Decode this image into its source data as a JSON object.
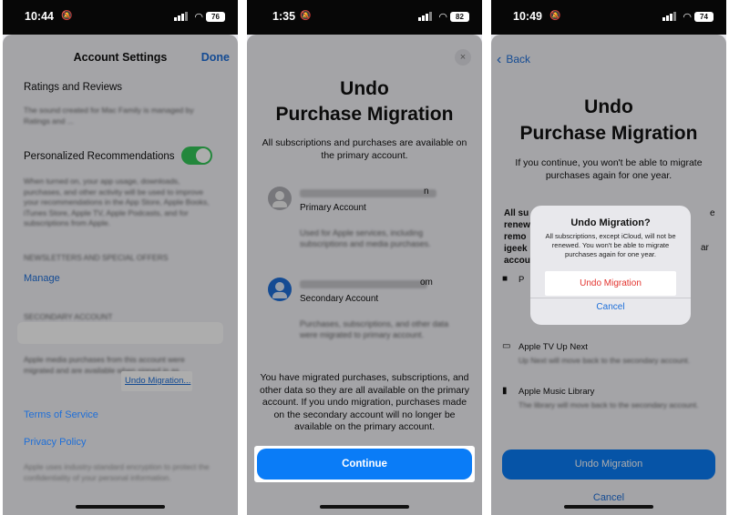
{
  "screens": [
    {
      "status": {
        "time": "10:44",
        "battery": "76"
      },
      "header": {
        "title": "Account Settings",
        "done": "Done"
      },
      "ratings": {
        "title": "Ratings and Reviews",
        "desc": "The sound created for Mac Family is managed by Ratings and ..."
      },
      "recommendations": {
        "title": "Personalized Recommendations",
        "desc": "When turned on, your app usage, downloads, purchases, and other activity will be used to improve your recommendations in the App Store, Apple Books, iTunes Store, Apple TV, Apple Podcasts, and for subscriptions from Apple."
      },
      "newsletters": {
        "header": "NEWSLETTERS AND SPECIAL OFFERS",
        "manage": "Manage"
      },
      "secondary": {
        "header": "SECONDARY ACCOUNT",
        "desc": "Apple media purchases from this account were migrated and are available when signed in as ...",
        "undo_link": "Undo Migration..."
      },
      "terms": "Terms of Service",
      "privacy": "Privacy Policy",
      "footer": "Apple uses industry-standard encryption to protect the confidentiality of your personal information."
    },
    {
      "status": {
        "time": "1:35",
        "battery": "82"
      },
      "close": "×",
      "title_line1": "Undo",
      "title_line2": "Purchase Migration",
      "subtitle": "All subscriptions and purchases are available on the primary account.",
      "primary": {
        "email_suffix": "n",
        "label": "Primary Account",
        "desc": "Used for Apple services, including subscriptions and media purchases."
      },
      "secondary": {
        "email_suffix": "om",
        "label": "Secondary Account",
        "desc": "Purchases, subscriptions, and other data were migrated to primary account."
      },
      "note": "You have migrated purchases, subscriptions, and other data so they are all available on the primary account. If you undo migration, purchases made on the secondary account will no longer be available on the primary account.",
      "continue": "Continue"
    },
    {
      "status": {
        "time": "10:49",
        "battery": "74"
      },
      "back": "Back",
      "title_line1": "Undo",
      "title_line2": "Purchase Migration",
      "subtitle": "If you continue, you won't be able to migrate purchases again for one year.",
      "partial": {
        "a": "All su",
        "a_tail": "e",
        "b": "renew",
        "c": "remo",
        "c_tail": "ar",
        "d": "igeek",
        "e": "accou",
        "p": "P"
      },
      "apple_tv": {
        "title": "Apple TV Up Next",
        "desc": "Up Next will move back to the secondary account."
      },
      "apple_music": {
        "title": "Apple Music Library",
        "desc": "The library will move back to the secondary account."
      },
      "undo_button": "Undo Migration",
      "cancel": "Cancel",
      "alert": {
        "title": "Undo Migration?",
        "message": "All subscriptions, except iCloud, will not be renewed. You won't be able to migrate purchases again for one year.",
        "undo": "Undo Migration",
        "cancel": "Cancel"
      }
    }
  ]
}
